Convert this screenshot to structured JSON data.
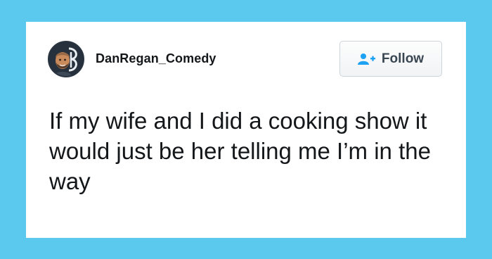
{
  "profile": {
    "username": "DanRegan_Comedy",
    "avatar_icon": "avatar-portrait-with-monogram"
  },
  "follow_button": {
    "label": "Follow",
    "icon": "add-user-icon",
    "icon_color": "#1da1f2"
  },
  "tweet": {
    "text": "If my wife and I did a cooking show it would just be her telling me I’m in the way"
  },
  "colors": {
    "background": "#5bc8ee",
    "card": "#ffffff",
    "text": "#14171a"
  }
}
